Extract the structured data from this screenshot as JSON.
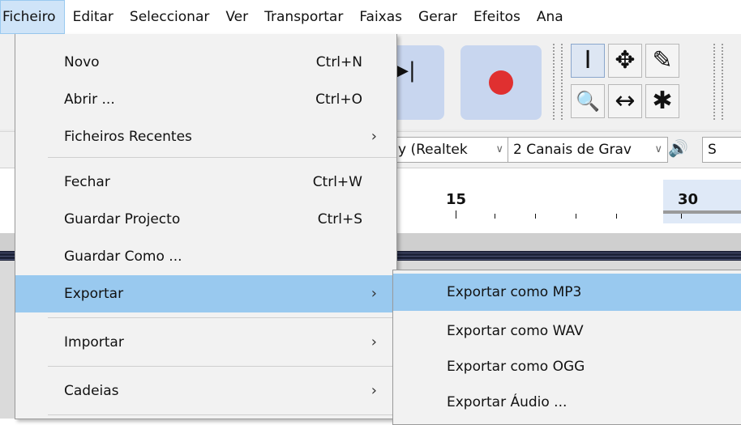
{
  "menubar": {
    "items": [
      "Ficheiro",
      "Editar",
      "Seleccionar",
      "Ver",
      "Transportar",
      "Faixas",
      "Gerar",
      "Efeitos",
      "Ana"
    ]
  },
  "file_menu": {
    "items": [
      {
        "label": "Novo",
        "shortcut": "Ctrl+N"
      },
      {
        "label": "Abrir ...",
        "shortcut": "Ctrl+O"
      },
      {
        "label": "Ficheiros Recentes",
        "submenu_arrow": "›"
      },
      {
        "label": "Fechar",
        "shortcut": "Ctrl+W"
      },
      {
        "label": "Guardar Projecto",
        "shortcut": "Ctrl+S"
      },
      {
        "label": "Guardar Como ..."
      },
      {
        "label": "Exportar",
        "submenu_arrow": "›"
      },
      {
        "label": "Importar",
        "submenu_arrow": "›"
      },
      {
        "label": "Cadeias",
        "submenu_arrow": "›"
      }
    ]
  },
  "export_submenu": {
    "items": [
      {
        "label": "Exportar como MP3"
      },
      {
        "label": "Exportar como WAV"
      },
      {
        "label": "Exportar como OGG"
      },
      {
        "label": "Exportar Áudio ..."
      }
    ]
  },
  "toolbar": {
    "icons": [
      "skip-to-end-icon",
      "record-icon",
      "selection-tool-icon",
      "envelope-tool-icon",
      "draw-tool-icon",
      "zoom-tool-icon",
      "time-shift-tool-icon",
      "multi-tool-icon"
    ],
    "tool_glyphs": {
      "select": "I",
      "envelope": "✥",
      "draw": "✎",
      "zoom": "🔍",
      "timeshift": "↔",
      "multi": "✱"
    }
  },
  "device_toolbar": {
    "input_device": "y (Realtek",
    "channels": "2 Canais de Grav",
    "chevron": "∨",
    "speaker_icon": "🔊",
    "cut_text": "S"
  },
  "timeline": {
    "labels": [
      "15",
      "30"
    ]
  },
  "colors": {
    "menu_highlight": "#99c9ef",
    "menubar_active": "#cfe4f8",
    "record_red": "#e03030",
    "button_blue": "#c8d6ef"
  }
}
